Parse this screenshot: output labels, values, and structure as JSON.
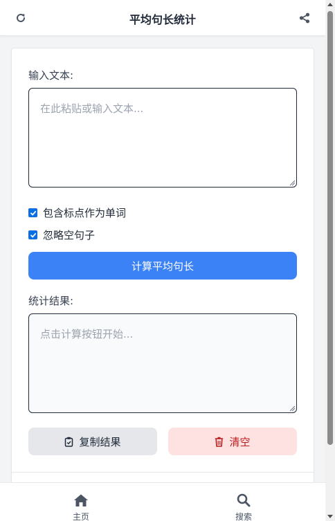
{
  "header": {
    "title": "平均句长统计",
    "refresh_icon": "refresh-icon",
    "share_icon": "share-icon"
  },
  "input": {
    "label": "输入文本:",
    "placeholder": "在此粘贴或输入文本...",
    "value": ""
  },
  "options": [
    {
      "label": "包含标点作为单词",
      "checked": true
    },
    {
      "label": "忽略空句子",
      "checked": true
    }
  ],
  "actions": {
    "calculate_label": "计算平均句长",
    "copy_label": "复制结果",
    "clear_label": "清空"
  },
  "result": {
    "label": "统计结果:",
    "placeholder": "点击计算按钮开始...",
    "value": ""
  },
  "bottom_nav": [
    {
      "label": "主页",
      "icon": "home-icon"
    },
    {
      "label": "搜索",
      "icon": "search-icon"
    }
  ],
  "colors": {
    "primary": "#3b82f6",
    "checkbox": "#0b6fe4",
    "danger_bg": "#fee2e2",
    "danger_text": "#b91c1c",
    "secondary_bg": "#e5e7eb"
  }
}
